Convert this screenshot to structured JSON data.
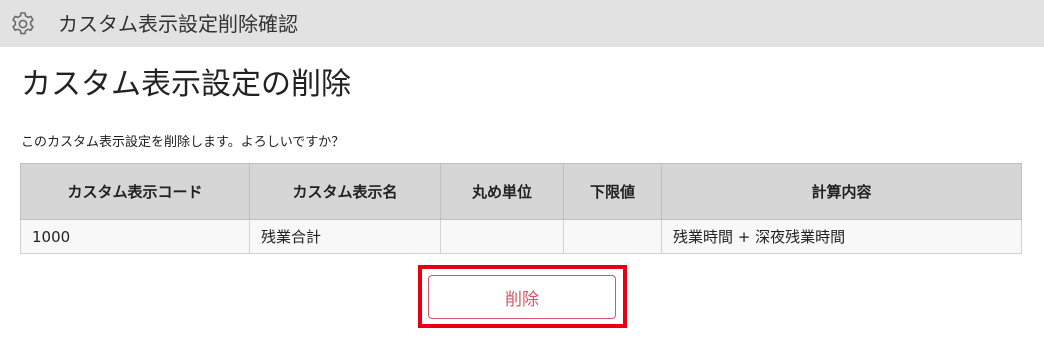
{
  "header": {
    "icon": "gear-icon",
    "title": "カスタム表示設定削除確認"
  },
  "main": {
    "page_title": "カスタム表示設定の削除",
    "confirm_message": "このカスタム表示設定を削除します。よろしいですか？",
    "table": {
      "columns": [
        "カスタム表示コード",
        "カスタム表示名",
        "丸め単位",
        "下限値",
        "計算内容"
      ],
      "rows": [
        [
          "1000",
          "残業合計",
          "",
          "",
          "残業時間 + 深夜残業時間"
        ]
      ]
    },
    "delete_label": "削除"
  },
  "colors": {
    "header_bg": "#e2e2e2",
    "table_header_bg": "#d6d6d6",
    "delete_text": "#d6566a",
    "highlight_border": "#e60012"
  }
}
